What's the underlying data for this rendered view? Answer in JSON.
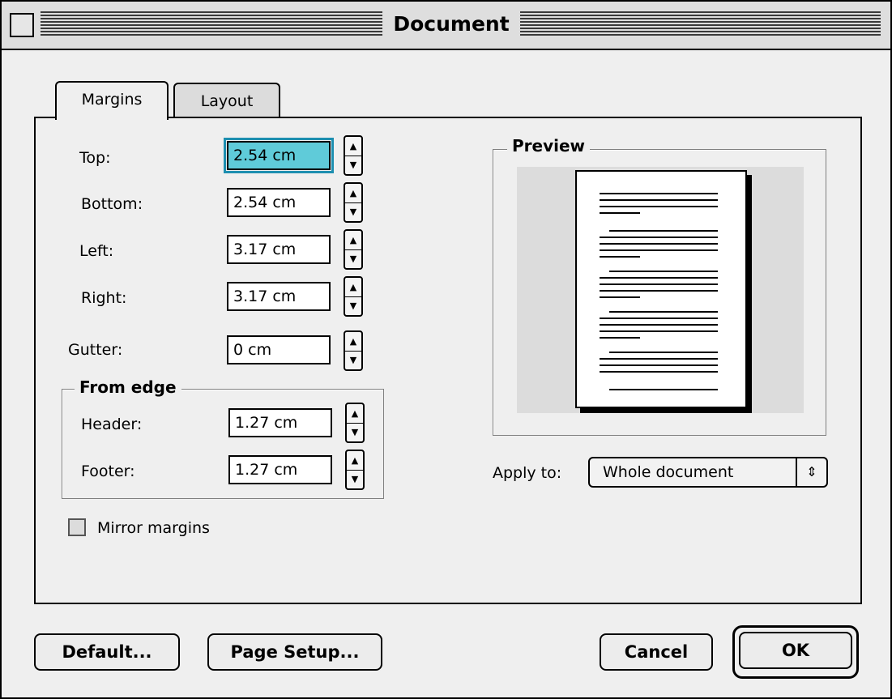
{
  "window": {
    "title": "Document"
  },
  "tabs": [
    {
      "label": "Margins",
      "active": true
    },
    {
      "label": "Layout",
      "active": false
    }
  ],
  "margins": {
    "top": {
      "label": "Top:",
      "value": "2.54 cm"
    },
    "bottom": {
      "label": "Bottom:",
      "value": "2.54 cm"
    },
    "left": {
      "label": "Left:",
      "value": "3.17 cm"
    },
    "right": {
      "label": "Right:",
      "value": "3.17 cm"
    },
    "gutter": {
      "label": "Gutter:",
      "value": "0 cm"
    }
  },
  "from_edge": {
    "title": "From edge",
    "header": {
      "label": "Header:",
      "value": "1.27 cm"
    },
    "footer": {
      "label": "Footer:",
      "value": "1.27 cm"
    }
  },
  "mirror_margins": {
    "label": "Mirror margins",
    "checked": false
  },
  "preview": {
    "title": "Preview"
  },
  "apply_to": {
    "label": "Apply to:",
    "value": "Whole document"
  },
  "buttons": {
    "default": "Default...",
    "page_setup": "Page Setup...",
    "cancel": "Cancel",
    "ok": "OK"
  },
  "icons": {
    "stepper_up": "up-arrow-icon",
    "stepper_down": "down-arrow-icon",
    "popup": "updown-arrows-icon"
  }
}
